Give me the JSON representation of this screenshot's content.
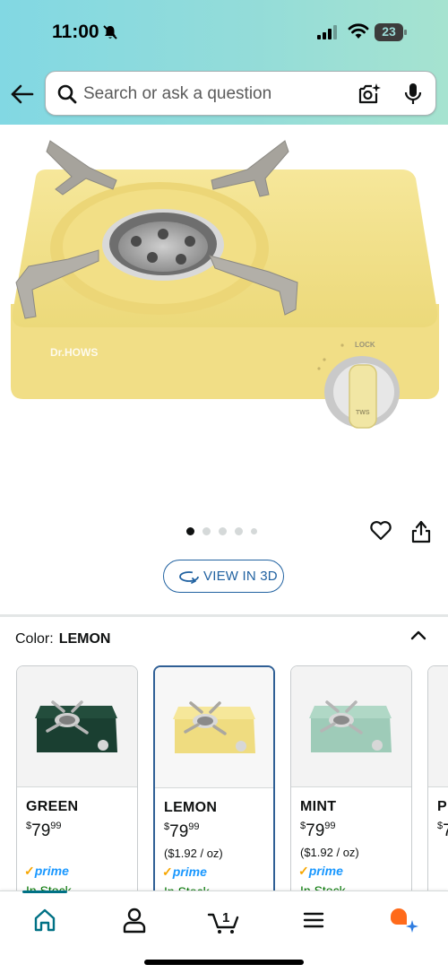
{
  "status_bar": {
    "time": "11:00",
    "battery_level": "23",
    "icons": [
      "bell-muted-icon",
      "signal-icon",
      "wifi-icon",
      "battery-icon"
    ]
  },
  "search": {
    "placeholder": "Search or ask a question",
    "icons": [
      "back-arrow-icon",
      "search-icon",
      "camera-icon",
      "mic-icon"
    ]
  },
  "product_image": {
    "brand_mark": "Dr.HOWS",
    "lock_label": "LOCK",
    "knob_label": "TWS"
  },
  "carousel": {
    "total_dots": 5,
    "active_index": 0
  },
  "actions": {
    "view_3d": "VIEW IN 3D",
    "icons": [
      "heart-icon",
      "share-icon",
      "3d-rotate-icon"
    ]
  },
  "color_selector": {
    "label": "Color:",
    "selected": "LEMON",
    "options": [
      {
        "name": "GREEN",
        "currency": "$",
        "dollars": "79",
        "cents": "99",
        "unit_price": "",
        "prime": "prime",
        "stock": "In Stock",
        "body_color": "#1f4a3a"
      },
      {
        "name": "LEMON",
        "currency": "$",
        "dollars": "79",
        "cents": "99",
        "unit_price": "($1.92 / oz)",
        "prime": "prime",
        "stock": "In Stock",
        "body_color": "#f3e38c"
      },
      {
        "name": "MINT",
        "currency": "$",
        "dollars": "79",
        "cents": "99",
        "unit_price": "($1.92 / oz)",
        "prime": "prime",
        "stock": "In Stock",
        "body_color": "#a9d3c0"
      },
      {
        "name": "P",
        "currency": "$",
        "dollars": "7",
        "cents": "",
        "unit_price": "",
        "prime": "",
        "stock": "",
        "body_color": "#f3f3f3"
      }
    ]
  },
  "bottom_nav": {
    "cart_count": "1",
    "items": [
      "home-icon",
      "account-icon",
      "cart-icon",
      "menu-icon",
      "rufus-ai-icon"
    ]
  },
  "colors": {
    "header_start": "#82d8e3",
    "header_end": "#a6e3d0",
    "link_blue": "#2162a1",
    "teal": "#007185",
    "prime_blue": "#1a98ff",
    "stock_green": "#007600"
  }
}
